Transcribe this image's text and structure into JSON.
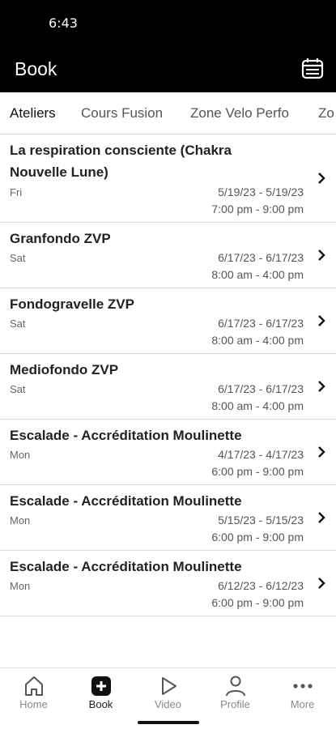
{
  "status_bar": {
    "time": "6:43"
  },
  "header": {
    "title": "Book"
  },
  "tabs": [
    {
      "label": "Ateliers",
      "active": true
    },
    {
      "label": "Cours Fusion",
      "active": false
    },
    {
      "label": "Zone Velo Perfo",
      "active": false
    },
    {
      "label": "Zo",
      "active": false
    }
  ],
  "events": [
    {
      "title_line1": "La respiration consciente (Chakra",
      "title_line2": "Nouvelle Lune)",
      "day": "Fri",
      "dates": "5/19/23 - 5/19/23",
      "times": "7:00 pm - 9:00 pm"
    },
    {
      "title_line1": "Granfondo ZVP",
      "day": "Sat",
      "dates": "6/17/23 - 6/17/23",
      "times": "8:00 am - 4:00 pm"
    },
    {
      "title_line1": "Fondogravelle ZVP",
      "day": "Sat",
      "dates": "6/17/23 - 6/17/23",
      "times": "8:00 am - 4:00 pm"
    },
    {
      "title_line1": "Mediofondo ZVP",
      "day": "Sat",
      "dates": "6/17/23 - 6/17/23",
      "times": "8:00 am - 4:00 pm"
    },
    {
      "title_line1": "Escalade - Accréditation Moulinette",
      "day": "Mon",
      "dates": "4/17/23 - 4/17/23",
      "times": "6:00 pm - 9:00 pm"
    },
    {
      "title_line1": "Escalade - Accréditation Moulinette",
      "day": "Mon",
      "dates": "5/15/23 - 5/15/23",
      "times": "6:00 pm - 9:00 pm"
    },
    {
      "title_line1": "Escalade - Accréditation Moulinette",
      "day": "Mon",
      "dates": "6/12/23 - 6/12/23",
      "times": "6:00 pm - 9:00 pm"
    }
  ],
  "bottom_nav": [
    {
      "label": "Home",
      "icon": "home-icon"
    },
    {
      "label": "Book",
      "icon": "plus-square-icon",
      "active": true
    },
    {
      "label": "Video",
      "icon": "play-icon"
    },
    {
      "label": "Profile",
      "icon": "person-icon"
    },
    {
      "label": "More",
      "icon": "ellipsis-icon"
    }
  ]
}
